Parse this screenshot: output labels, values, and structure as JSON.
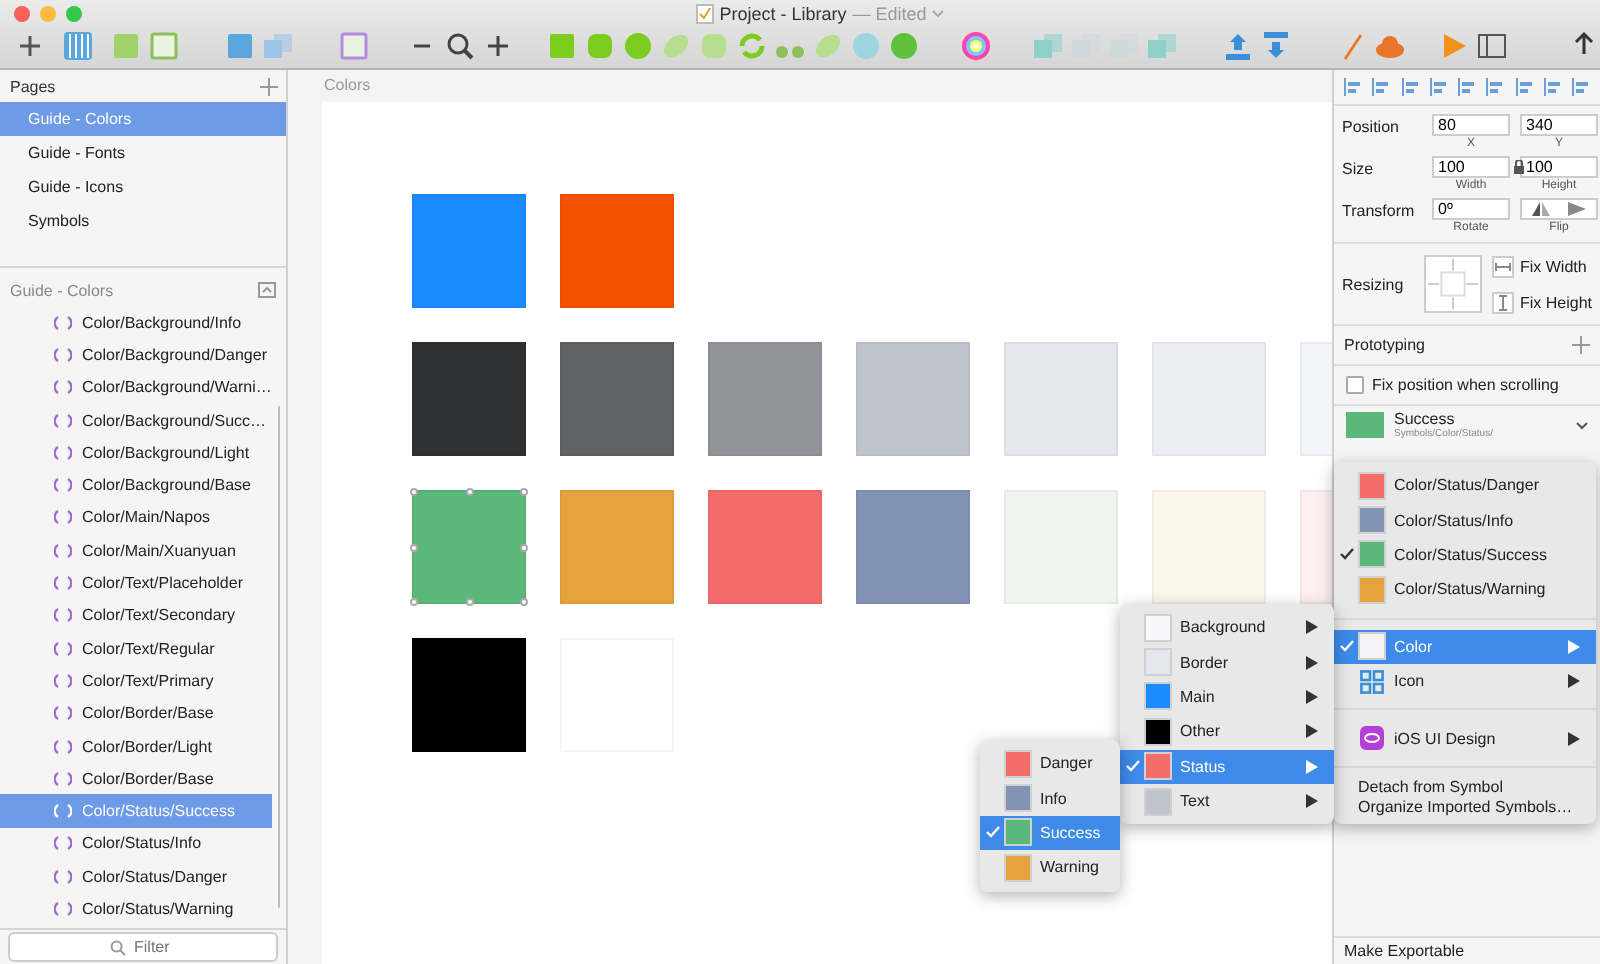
{
  "window": {
    "title": "Project - Library",
    "status": "— Edited"
  },
  "pages": {
    "title": "Pages",
    "items": [
      {
        "label": "Guide - Colors",
        "selected": true
      },
      {
        "label": "Guide - Fonts",
        "selected": false
      },
      {
        "label": "Guide - Icons",
        "selected": false
      },
      {
        "label": "Symbols",
        "selected": false
      }
    ]
  },
  "layers": {
    "title": "Guide - Colors",
    "filter_placeholder": "Filter",
    "items": [
      {
        "label": "Color/Background/Info",
        "selected": false
      },
      {
        "label": "Color/Background/Danger",
        "selected": false
      },
      {
        "label": "Color/Background/Warni…",
        "selected": false
      },
      {
        "label": "Color/Background/Succ…",
        "selected": false
      },
      {
        "label": "Color/Background/Light",
        "selected": false
      },
      {
        "label": "Color/Background/Base",
        "selected": false
      },
      {
        "label": "Color/Main/Napos",
        "selected": false
      },
      {
        "label": "Color/Main/Xuanyuan",
        "selected": false
      },
      {
        "label": "Color/Text/Placeholder",
        "selected": false
      },
      {
        "label": "Color/Text/Secondary",
        "selected": false
      },
      {
        "label": "Color/Text/Regular",
        "selected": false
      },
      {
        "label": "Color/Text/Primary",
        "selected": false
      },
      {
        "label": "Color/Border/Base",
        "selected": false
      },
      {
        "label": "Color/Border/Light",
        "selected": false
      },
      {
        "label": "Color/Border/Base",
        "selected": false
      },
      {
        "label": "Color/Status/Success",
        "selected": true
      },
      {
        "label": "Color/Status/Info",
        "selected": false
      },
      {
        "label": "Color/Status/Danger",
        "selected": false
      },
      {
        "label": "Color/Status/Warning",
        "selected": false
      }
    ]
  },
  "canvas": {
    "artboard_title": "Colors",
    "rows": [
      [
        {
          "color": "#1a8cff",
          "selected": false
        },
        {
          "color": "#f55200",
          "selected": false
        }
      ],
      [
        {
          "color": "#303133",
          "selected": false
        },
        {
          "color": "#606266",
          "selected": false
        },
        {
          "color": "#909399",
          "selected": false
        },
        {
          "color": "#c0c4cc",
          "selected": false
        },
        {
          "color": "#e4e7ed",
          "selected": false
        },
        {
          "color": "#ebeef5",
          "selected": false
        },
        {
          "color": "#f2f6fc",
          "selected": false
        }
      ],
      [
        {
          "color": "#5cb87a",
          "selected": true
        },
        {
          "color": "#e6a23c",
          "selected": false
        },
        {
          "color": "#f56c6c",
          "selected": false
        },
        {
          "color": "#8393b3",
          "selected": false
        },
        {
          "color": "#eef5ef",
          "selected": false
        },
        {
          "color": "#fdf6ec",
          "selected": false
        },
        {
          "color": "#fef0f0",
          "selected": false
        }
      ],
      [
        {
          "color": "#000000",
          "selected": false
        },
        {
          "color": "#ffffff",
          "selected": false
        }
      ]
    ]
  },
  "inspector": {
    "rows": [
      {
        "label": "Position",
        "kind": "pair",
        "inputs": [
          {
            "value": "80",
            "caption": "X"
          },
          {
            "value": "340",
            "caption": "Y"
          }
        ]
      },
      {
        "label": "Size",
        "kind": "lock",
        "inputs": [
          {
            "value": "100",
            "caption": "Width"
          },
          {
            "value": "100",
            "caption": "Height"
          }
        ]
      },
      {
        "label": "Transform",
        "kind": "flip",
        "inputs": [
          {
            "value": "0º",
            "caption": "Rotate"
          }
        ],
        "flip_caption": "Flip"
      }
    ],
    "resizing": {
      "label": "Resizing",
      "options": [
        {
          "label": "Fix Width",
          "kind": "width"
        },
        {
          "label": "Fix Height",
          "kind": "height"
        }
      ]
    },
    "prototyping": {
      "title": "Prototyping",
      "option": {
        "label": "Fix position when scrolling",
        "checked": false
      }
    },
    "symbol": {
      "name": "Success",
      "path": "Symbols/Color/Status/"
    },
    "export": {
      "label": "Make Exportable"
    }
  },
  "symbol_menu": {
    "items": [
      {
        "kind": "swatch",
        "label": "Color/Status/Danger",
        "color": "#f56c6c",
        "checked": false,
        "selected": false
      },
      {
        "kind": "swatch",
        "label": "Color/Status/Info",
        "color": "#8393b3",
        "checked": false,
        "selected": false
      },
      {
        "kind": "swatch",
        "label": "Color/Status/Success",
        "color": "#5cb87a",
        "checked": true,
        "selected": false
      },
      {
        "kind": "swatch",
        "label": "Color/Status/Warning",
        "color": "#e6a23c",
        "checked": false,
        "selected": false
      },
      {
        "kind": "separator"
      },
      {
        "kind": "folder",
        "label": "Color",
        "color": "#f4f4f6",
        "checked": true,
        "selected": true
      },
      {
        "kind": "grid",
        "label": "Icon",
        "checked": false,
        "selected": false
      },
      {
        "kind": "separator"
      },
      {
        "kind": "library",
        "label": "iOS UI Design",
        "checked": false,
        "selected": false
      },
      {
        "kind": "separator"
      },
      {
        "kind": "action",
        "label": "Detach from Symbol"
      },
      {
        "kind": "action",
        "label": "Organize Imported Symbols…"
      }
    ]
  },
  "category_menu": {
    "items": [
      {
        "kind": "folder",
        "label": "Background",
        "color": "#f8f8fa",
        "checked": false,
        "selected": false
      },
      {
        "kind": "folder",
        "label": "Border",
        "color": "#e4e7ed",
        "checked": false,
        "selected": false
      },
      {
        "kind": "folder",
        "label": "Main",
        "color": "#1a8cff",
        "checked": false,
        "selected": false
      },
      {
        "kind": "folder",
        "label": "Other",
        "color": "#000000",
        "checked": false,
        "selected": false
      },
      {
        "kind": "folder",
        "label": "Status",
        "color": "#f56c6c",
        "checked": true,
        "selected": true
      },
      {
        "kind": "folder",
        "label": "Text",
        "color": "#c0c4cc",
        "checked": false,
        "selected": false
      }
    ]
  },
  "status_menu": {
    "items": [
      {
        "kind": "swatch",
        "label": "Danger",
        "color": "#f56c6c",
        "checked": false,
        "selected": false
      },
      {
        "kind": "swatch",
        "label": "Info",
        "color": "#8393b3",
        "checked": false,
        "selected": false
      },
      {
        "kind": "swatch",
        "label": "Success",
        "color": "#5cb87a",
        "checked": true,
        "selected": true
      },
      {
        "kind": "swatch",
        "label": "Warning",
        "color": "#e6a23c",
        "checked": false,
        "selected": false
      }
    ]
  }
}
